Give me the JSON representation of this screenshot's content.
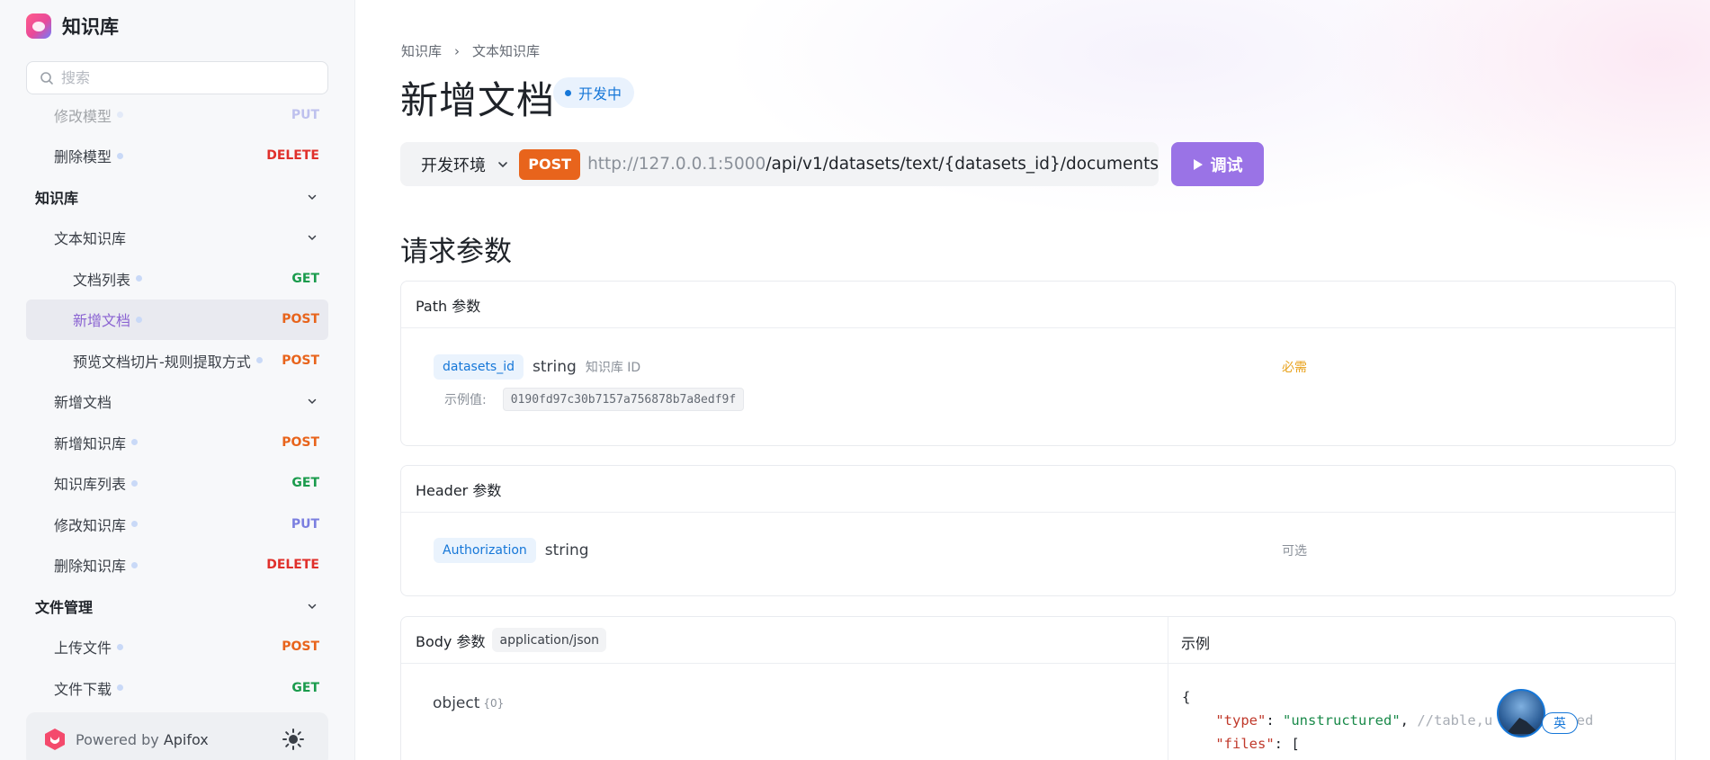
{
  "app": {
    "title": "知识库"
  },
  "search": {
    "placeholder": "搜索"
  },
  "nav": [
    {
      "label": "修改模型",
      "method": "PUT",
      "level": 1,
      "dot": true,
      "faded": true
    },
    {
      "label": "删除模型",
      "method": "DELETE",
      "level": 1,
      "dot": true
    },
    {
      "label": "知识库",
      "level": 0,
      "chevron": true
    },
    {
      "label": "文本知识库",
      "level": 1,
      "chevron": true
    },
    {
      "label": "文档列表",
      "method": "GET",
      "level": 2,
      "dot": true
    },
    {
      "label": "新增文档",
      "method": "POST",
      "level": 2,
      "dot": true,
      "active": true
    },
    {
      "label": "预览文档切片-规则提取方式",
      "method": "POST",
      "level": 2,
      "dot": true
    },
    {
      "label": "新增文档",
      "level": 1,
      "chevron": true
    },
    {
      "label": "新增知识库",
      "method": "POST",
      "level": 1,
      "dot": true
    },
    {
      "label": "知识库列表",
      "method": "GET",
      "level": 1,
      "dot": true
    },
    {
      "label": "修改知识库",
      "method": "PUT",
      "level": 1,
      "dot": true
    },
    {
      "label": "删除知识库",
      "method": "DELETE",
      "level": 1,
      "dot": true
    },
    {
      "label": "文件管理",
      "level": 0,
      "chevron": true
    },
    {
      "label": "上传文件",
      "method": "POST",
      "level": 1,
      "dot": true
    },
    {
      "label": "文件下载",
      "method": "GET",
      "level": 1,
      "dot": true
    }
  ],
  "footer": {
    "powered_prefix": "Powered by",
    "powered_brand": "Apifox"
  },
  "breadcrumb": {
    "items": [
      "知识库",
      "文本知识库"
    ],
    "separator": "›"
  },
  "page": {
    "title": "新增文档",
    "status": "开发中"
  },
  "request": {
    "env": "开发环境",
    "method": "POST",
    "host": "http://127.0.0.1:5000",
    "path": "/api/v1/datasets/text/{datasets_id}/documents",
    "try_label": "调试"
  },
  "sections": {
    "request_params": "请求参数"
  },
  "path_params": {
    "header": "Path 参数",
    "name": "datasets_id",
    "type": "string",
    "description": "知识库 ID",
    "required": "必需",
    "example_label": "示例值:",
    "example_value": "0190fd97c30b7157a756878b7a8edf9f"
  },
  "header_params": {
    "header": "Header 参数",
    "name": "Authorization",
    "type": "string",
    "optional": "可选"
  },
  "body_params": {
    "header": "Body 参数",
    "content_type": "application/json",
    "example_header": "示例",
    "root_type": "object",
    "root_count": "{0}",
    "code_lines": [
      {
        "parts": [
          {
            "t": "p",
            "v": "{"
          }
        ]
      },
      {
        "parts": [
          {
            "t": "p",
            "v": "    "
          },
          {
            "t": "k",
            "v": "\"type\""
          },
          {
            "t": "p",
            "v": ": "
          },
          {
            "t": "s",
            "v": "\"unstructured\""
          },
          {
            "t": "p",
            "v": ", "
          },
          {
            "t": "c",
            "v": "//table,u          ed"
          }
        ]
      },
      {
        "parts": [
          {
            "t": "p",
            "v": "    "
          },
          {
            "t": "k",
            "v": "\"files\""
          },
          {
            "t": "p",
            "v": ": ["
          }
        ]
      },
      {
        "parts": [
          {
            "t": "p",
            "v": "      {"
          }
        ]
      }
    ]
  },
  "overlay": {
    "ime_label": "英"
  },
  "colors": {
    "accent": "#9a73e6",
    "post": "#e8641c",
    "get": "#1a9b4c",
    "put": "#7b7fe0",
    "delete": "#e0302b",
    "info": "#1677d8"
  }
}
